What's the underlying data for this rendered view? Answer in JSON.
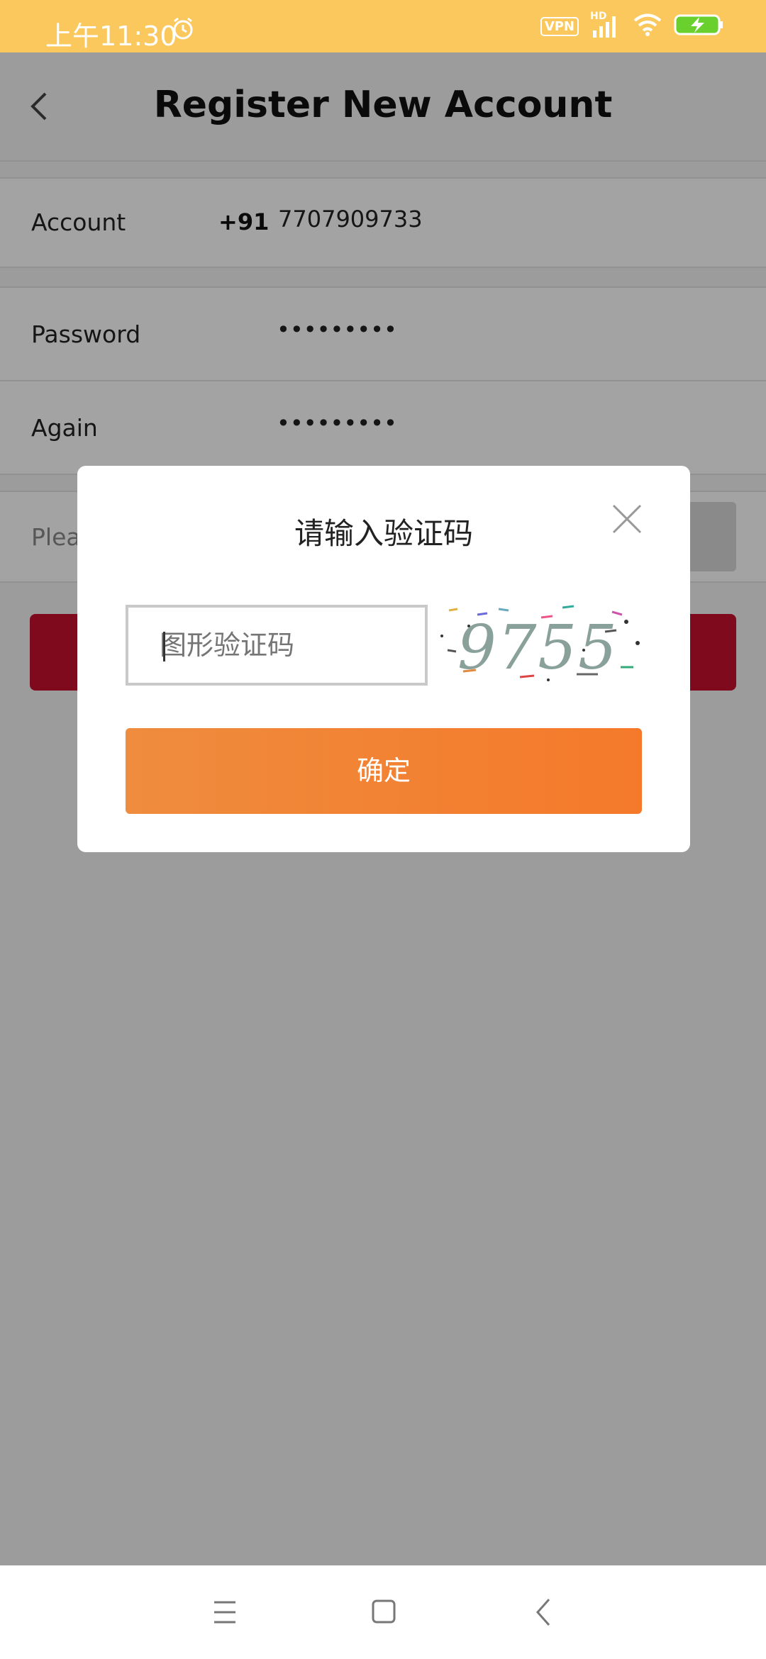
{
  "status_bar": {
    "time": "上午11:30",
    "vpn_label": "VPN",
    "network_label": "HD",
    "icons": [
      "alarm-icon",
      "vpn-icon",
      "signal-icon",
      "wifi-icon",
      "battery-charging-icon"
    ],
    "color": "#fac85c"
  },
  "header": {
    "title": "Register New Account"
  },
  "form": {
    "account_label": "Account",
    "country_code": "+91",
    "account_value": "7707909733",
    "password_label": "Password",
    "password_value": "•••••••••",
    "again_label": "Again",
    "again_value": "•••••••••",
    "verification_placeholder_partial": "Plea",
    "submit_color": "#c8102e"
  },
  "modal": {
    "title": "请输入验证码",
    "captcha_placeholder": "图形验证码",
    "captcha_text": "9755",
    "confirm_label": "确定",
    "confirm_color": "#f5792a"
  },
  "navbar": {
    "icons": [
      "menu-icon",
      "home-square-icon",
      "back-chevron-icon"
    ]
  }
}
